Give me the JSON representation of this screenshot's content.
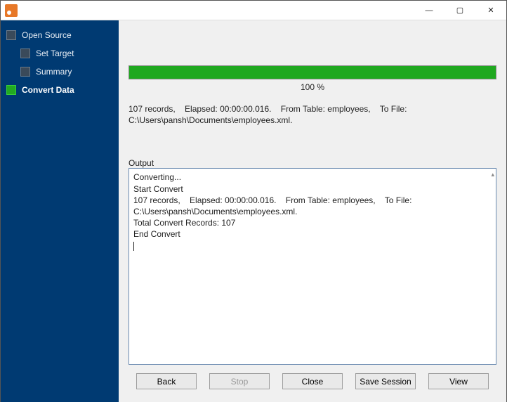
{
  "window": {
    "minimize": "—",
    "maximize": "▢",
    "close": "✕"
  },
  "sidebar": {
    "items": [
      {
        "label": "Open Source",
        "depth": 0,
        "active": false
      },
      {
        "label": "Set Target",
        "depth": 1,
        "active": false
      },
      {
        "label": "Summary",
        "depth": 1,
        "active": false
      },
      {
        "label": "Convert Data",
        "depth": 0,
        "active": true
      }
    ]
  },
  "progress": {
    "percent": 100,
    "label": "100 %"
  },
  "status": "107 records,    Elapsed: 00:00:00.016.    From Table: employees,    To File: C:\\Users\\pansh\\Documents\\employees.xml.",
  "output": {
    "label": "Output",
    "text": "Converting...\nStart Convert\n107 records,    Elapsed: 00:00:00.016.    From Table: employees,    To File: C:\\Users\\pansh\\Documents\\employees.xml.\nTotal Convert Records: 107\nEnd Convert"
  },
  "buttons": {
    "back": "Back",
    "stop": "Stop",
    "close": "Close",
    "save_session": "Save Session",
    "view": "View"
  }
}
